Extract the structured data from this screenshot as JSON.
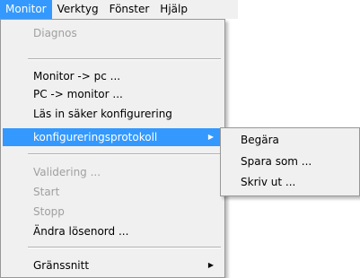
{
  "menubar": {
    "items": [
      {
        "label": "Monitor"
      },
      {
        "label": "Verktyg"
      },
      {
        "label": "Fönster"
      },
      {
        "label": "Hjälp"
      }
    ]
  },
  "monitor_menu": {
    "diagnos": "Diagnos",
    "monitor_to_pc": "Monitor -> pc ...",
    "pc_to_monitor": "PC -> monitor ...",
    "load_safe_config": "Läs in säker konfigurering",
    "config_protocol": "konfigureringsprotokoll",
    "validering": "Validering ...",
    "start": "Start",
    "stopp": "Stopp",
    "change_password": "Ändra lösenord ...",
    "interface": "Gränssnitt"
  },
  "submenu": {
    "begara": "Begära",
    "spara_som": "Spara som ...",
    "skriv_ut": "Skriv ut ..."
  },
  "icons": {
    "submenu_arrow": "▶"
  },
  "colors": {
    "highlight": "#3399ff",
    "menu_bg": "#f0f0f0",
    "disabled_text": "#a0a0a0"
  }
}
